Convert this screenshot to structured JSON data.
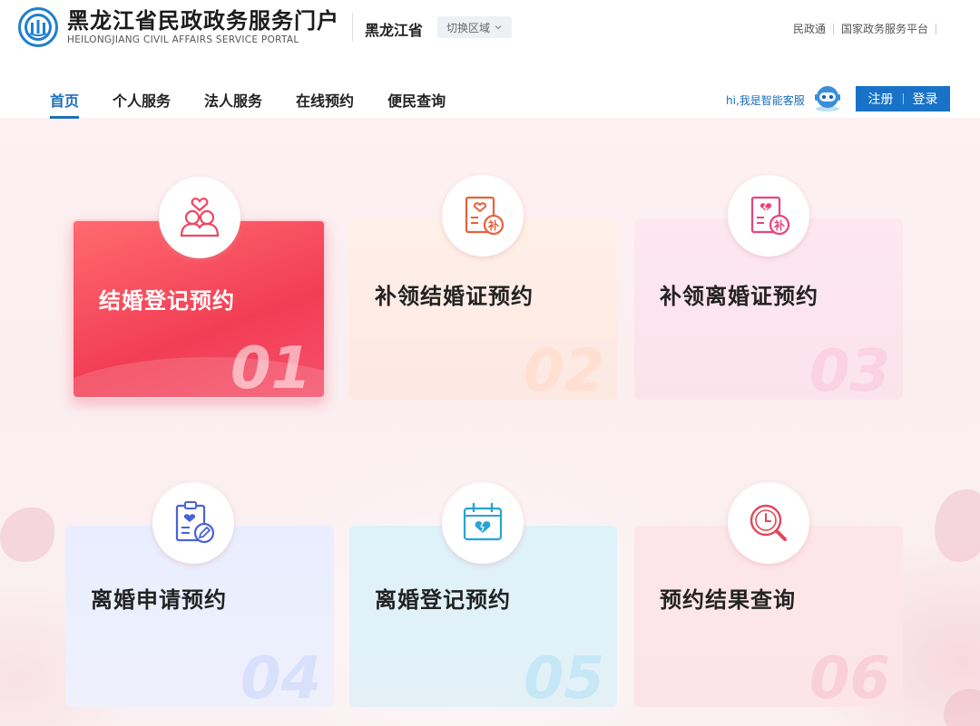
{
  "header": {
    "title": "黑龙江省民政政务服务门户",
    "subtitle": "HEILONGJIANG CIVIL AFFAIRS SERVICE PORTAL",
    "region": "黑龙江省",
    "switch_label": "切换区域",
    "top_links": [
      "民政通",
      "国家政务服务平台"
    ]
  },
  "nav": {
    "items": [
      "首页",
      "个人服务",
      "法人服务",
      "在线预约",
      "便民查询"
    ],
    "active": "首页"
  },
  "assistant": {
    "text": "hi,我是智能客服"
  },
  "auth": {
    "register": "注册",
    "login": "登录"
  },
  "cards": [
    {
      "title": "结婚登记预约",
      "num": "01",
      "icon": "couple-heart-icon"
    },
    {
      "title": "补领结婚证预约",
      "num": "02",
      "icon": "certificate-replace-icon"
    },
    {
      "title": "补领离婚证预约",
      "num": "03",
      "icon": "broken-certificate-replace-icon"
    },
    {
      "title": "离婚申请预约",
      "num": "04",
      "icon": "clipboard-edit-icon"
    },
    {
      "title": "离婚登记预约",
      "num": "05",
      "icon": "calendar-broken-heart-icon"
    },
    {
      "title": "预约结果查询",
      "num": "06",
      "icon": "clock-search-icon"
    }
  ],
  "colors": {
    "brand_blue": "#1c6fb8",
    "active_card": "#f23e55"
  }
}
